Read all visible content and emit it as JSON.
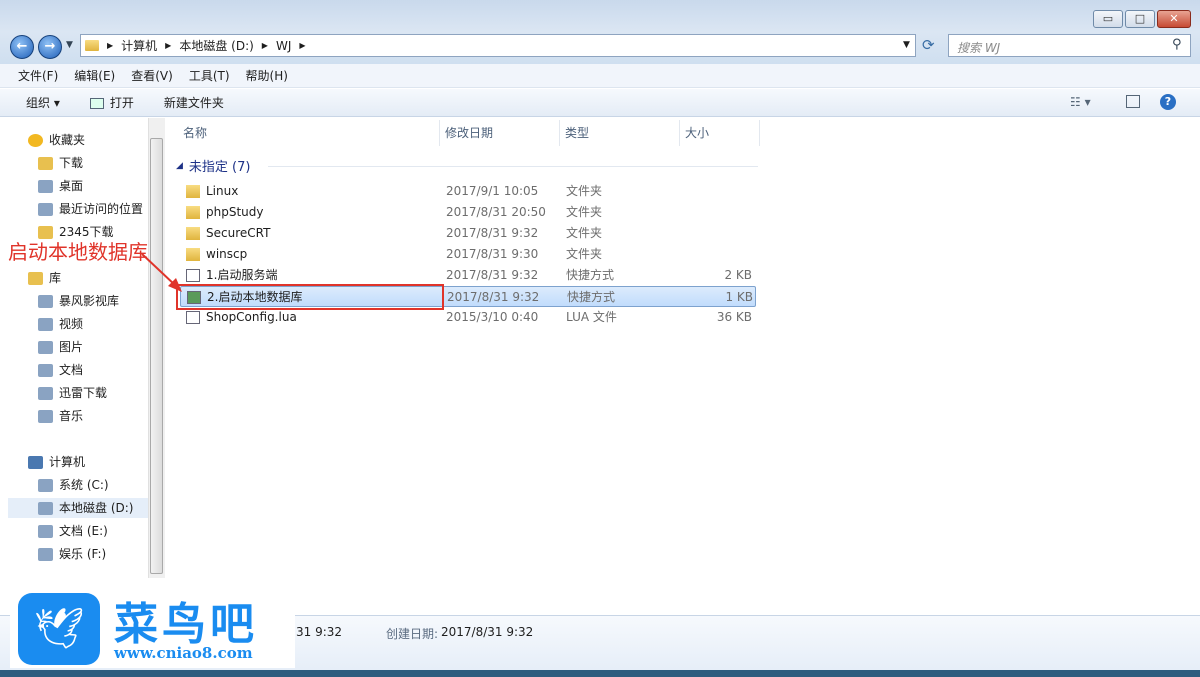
{
  "window": {
    "minimize": "▭",
    "maximize": "□",
    "close": "✕"
  },
  "address": {
    "crumbs": [
      "计算机",
      "本地磁盘 (D:)",
      "WJ"
    ],
    "search_placeholder": "搜索 WJ"
  },
  "menu": [
    "文件(F)",
    "编辑(E)",
    "查看(V)",
    "工具(T)",
    "帮助(H)"
  ],
  "toolbar": {
    "organize": "组织 ▾",
    "open": "打开",
    "new_folder": "新建文件夹"
  },
  "nav": [
    {
      "label": "收藏夹",
      "icon": "star-icon",
      "level": 0
    },
    {
      "label": "下载",
      "icon": "download-folder-icon",
      "level": 1
    },
    {
      "label": "桌面",
      "icon": "desktop-icon",
      "level": 1
    },
    {
      "label": "最近访问的位置",
      "icon": "recent-icon",
      "level": 1
    },
    {
      "label": "2345下载",
      "icon": "folder-icon",
      "level": 1
    },
    {
      "label": "库",
      "icon": "library-icon",
      "level": 0
    },
    {
      "label": "暴风影视库",
      "icon": "video-library-icon",
      "level": 1
    },
    {
      "label": "视频",
      "icon": "video-icon",
      "level": 1
    },
    {
      "label": "图片",
      "icon": "picture-icon",
      "level": 1
    },
    {
      "label": "文档",
      "icon": "document-icon",
      "level": 1
    },
    {
      "label": "迅雷下载",
      "icon": "download-icon",
      "level": 1
    },
    {
      "label": "音乐",
      "icon": "music-icon",
      "level": 1
    },
    {
      "label": "计算机",
      "icon": "computer-icon",
      "level": 0
    },
    {
      "label": "系统 (C:)",
      "icon": "system-drive-icon",
      "level": 1
    },
    {
      "label": "本地磁盘 (D:)",
      "icon": "drive-icon",
      "level": 1
    },
    {
      "label": "文档 (E:)",
      "icon": "drive-icon",
      "level": 1
    },
    {
      "label": "娱乐 (F:)",
      "icon": "drive-icon",
      "level": 1
    }
  ],
  "columns": [
    "名称",
    "修改日期",
    "类型",
    "大小"
  ],
  "group": "未指定 (7)",
  "files": [
    {
      "name": "Linux",
      "date": "2017/9/1 10:05",
      "type": "文件夹",
      "size": ""
    },
    {
      "name": "phpStudy",
      "date": "2017/8/31 20:50",
      "type": "文件夹",
      "size": ""
    },
    {
      "name": "SecureCRT",
      "date": "2017/8/31 9:32",
      "type": "文件夹",
      "size": ""
    },
    {
      "name": "winscp",
      "date": "2017/8/31 9:30",
      "type": "文件夹",
      "size": ""
    },
    {
      "name": "1.启动服务端",
      "date": "2017/8/31 9:32",
      "type": "快捷方式",
      "size": "2 KB"
    },
    {
      "name": "2.启动本地数据库",
      "date": "2017/8/31 9:32",
      "type": "快捷方式",
      "size": "1 KB"
    },
    {
      "name": "ShopConfig.lua",
      "date": "2015/3/10 0:40",
      "type": "LUA 文件",
      "size": "36 KB"
    }
  ],
  "annotation": "启动本地数据库",
  "details": {
    "modified": "31 9:32",
    "created_label": "创建日期:",
    "created": "2017/8/31 9:32"
  },
  "watermark": {
    "name": "菜鸟吧",
    "url": "www.cniao8.com"
  }
}
